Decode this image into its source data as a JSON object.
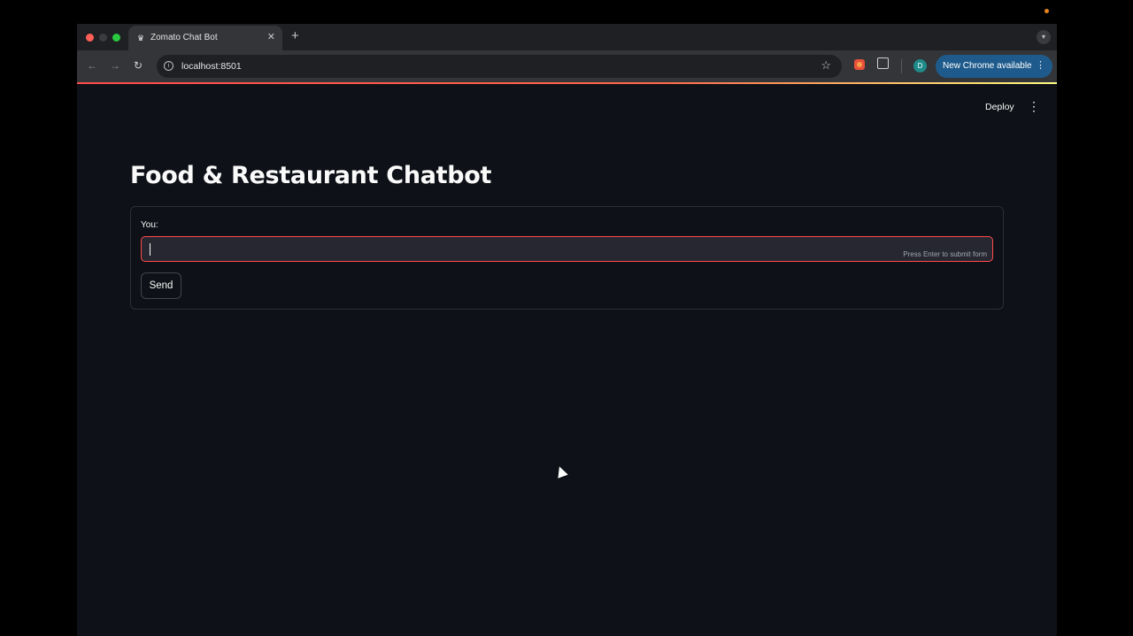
{
  "browser": {
    "tab_title": "Zomato Chat Bot",
    "tab_close": "✕",
    "new_tab": "+",
    "url": "localhost:8501",
    "update_label": "New Chrome available",
    "avatar_initial": "D"
  },
  "app": {
    "deploy_label": "Deploy",
    "title": "Food & Restaurant Chatbot",
    "form": {
      "input_label": "You:",
      "input_value": "",
      "hint": "Press Enter to submit form",
      "send_label": "Send"
    }
  },
  "colors": {
    "background": "#0e1117",
    "accent": "#ff4b4b",
    "update_pill": "#1e5b8c"
  }
}
